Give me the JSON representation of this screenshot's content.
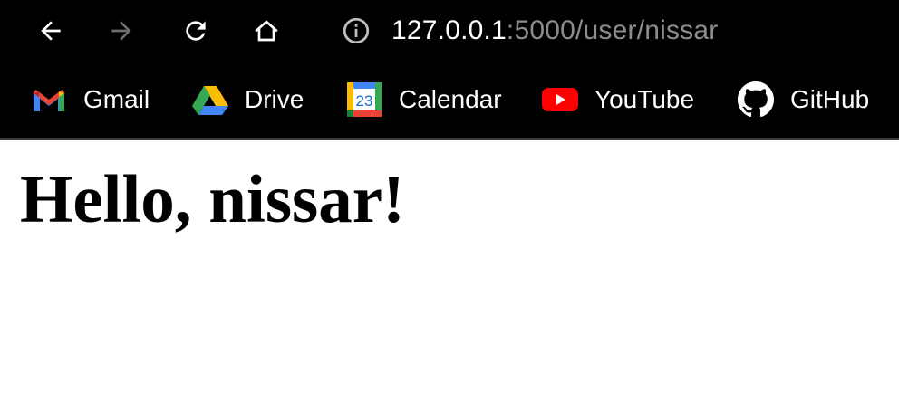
{
  "browser": {
    "url": {
      "host": "127.0.0.1",
      "rest": ":5000/user/nissar"
    },
    "nav": {
      "back_icon": "back-arrow-icon",
      "forward_icon": "forward-arrow-icon",
      "reload_icon": "reload-icon",
      "home_icon": "home-icon",
      "site_info_icon": "info-icon"
    },
    "bookmarks": [
      {
        "label": "Gmail",
        "icon": "gmail-icon"
      },
      {
        "label": "Drive",
        "icon": "drive-icon"
      },
      {
        "label": "Calendar",
        "icon": "calendar-icon",
        "icon_text": "23"
      },
      {
        "label": "YouTube",
        "icon": "youtube-icon"
      },
      {
        "label": "GitHub",
        "icon": "github-icon"
      }
    ],
    "colors": {
      "chrome_bg": "#000000",
      "url_host": "#ffffff",
      "url_rest": "#8c8c8c"
    }
  },
  "page": {
    "heading": "Hello, nissar!"
  }
}
